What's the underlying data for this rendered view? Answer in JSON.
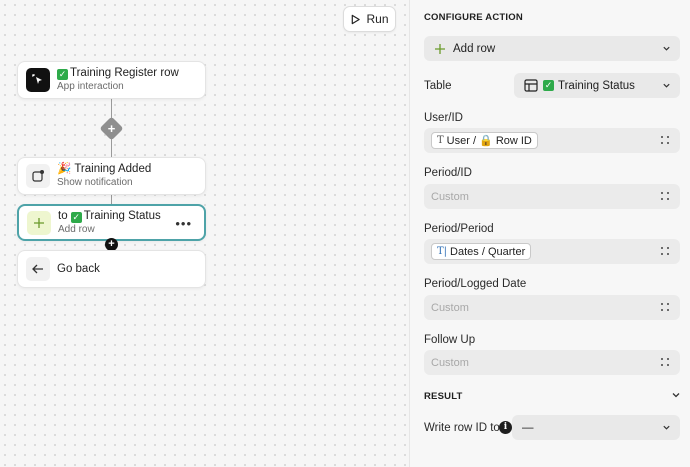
{
  "canvas": {
    "run_label": "Run",
    "nodes": [
      {
        "title": "Training Register row",
        "subtitle": "App interaction"
      },
      {
        "title": "Training Added",
        "subtitle": "Show notification"
      },
      {
        "title_prefix": "to",
        "title": "Training Status",
        "subtitle": "Add row"
      },
      {
        "title": "Go back"
      }
    ]
  },
  "panel": {
    "configure_title": "CONFIGURE ACTION",
    "action_select": "Add row",
    "table_label": "Table",
    "table_value": "Training Status",
    "fields": [
      {
        "label": "User/ID",
        "chip": "User / 🔒 Row ID"
      },
      {
        "label": "Period/ID",
        "placeholder": "Custom"
      },
      {
        "label": "Period/Period",
        "chip": "Dates / Quarter"
      },
      {
        "label": "Period/Logged Date",
        "placeholder": "Custom"
      },
      {
        "label": "Follow Up",
        "placeholder": "Custom"
      }
    ],
    "result_title": "RESULT",
    "write_row_label": "Write row ID to",
    "write_row_value": "—"
  },
  "colors": {
    "accent_border": "#4ea3a8",
    "check_green": "#2eaa4a"
  }
}
